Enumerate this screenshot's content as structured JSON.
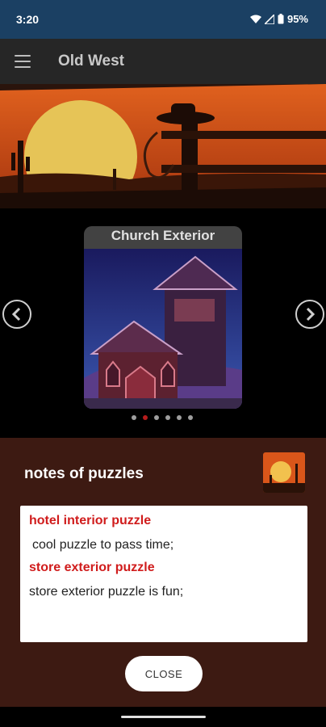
{
  "status_bar": {
    "time": "3:20",
    "battery": "95%"
  },
  "app_bar": {
    "title": "Old West",
    "menu_icon": "menu-icon"
  },
  "carousel": {
    "current_title": "Church Exterior",
    "dot_count": 6,
    "active_index": 1,
    "prev_icon": "chevron-left-icon",
    "next_icon": "chevron-right-icon"
  },
  "dialog": {
    "title": "notes of puzzles",
    "notes": [
      {
        "title": "hotel interior puzzle",
        "body": "cool puzzle to pass time;"
      },
      {
        "title": "store exterior puzzle",
        "body": "store exterior puzzle is fun;"
      }
    ],
    "close_label": "CLOSE"
  },
  "colors": {
    "status_bar": "#1b4063",
    "app_bar": "#262626",
    "dialog_bg": "#3d1a12",
    "note_title": "#d01c1c",
    "active_dot": "#b71c1c"
  }
}
